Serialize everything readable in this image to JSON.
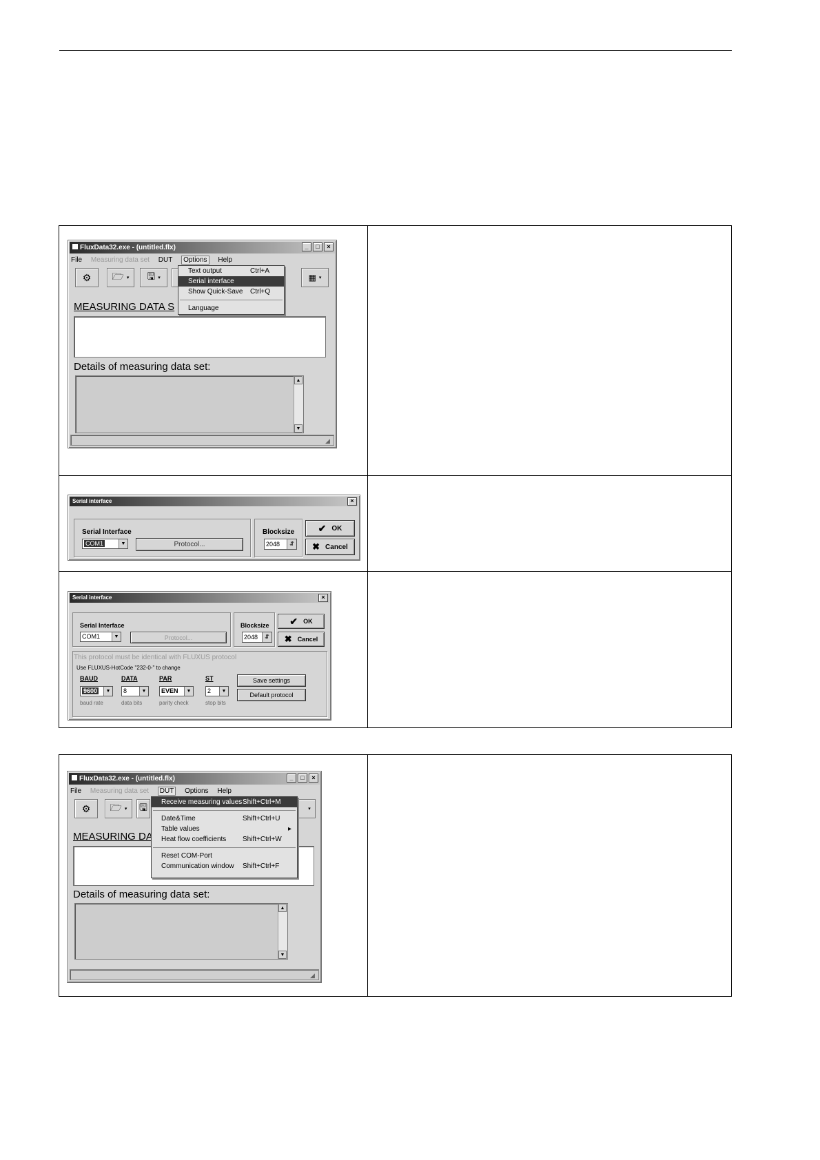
{
  "app": {
    "window_title": "FluxData32.exe - (untitled.flx)",
    "window_buttons": [
      "_",
      "□",
      "×"
    ],
    "menu": {
      "file": "File",
      "measuring_data_set": "Measuring data set",
      "dut": "DUT",
      "options": "Options",
      "help": "Help"
    },
    "measuring_data_label": "MEASURING DATA S",
    "measuring_data_label_short": "MEASURING DA",
    "details_label": "Details of measuring data set:"
  },
  "options_menu": {
    "items": [
      {
        "label": "Text output",
        "shortcut": "Ctrl+A"
      },
      {
        "label": "Serial interface",
        "shortcut": ""
      },
      {
        "label": "Show Quick-Save",
        "shortcut": "Ctrl+Q"
      },
      {
        "label": "Language",
        "shortcut": ""
      }
    ]
  },
  "dut_menu": {
    "items": [
      {
        "label": "Receive measuring values",
        "shortcut": "Shift+Ctrl+M"
      },
      {
        "label": "Date&Time",
        "shortcut": "Shift+Ctrl+U"
      },
      {
        "label": "Table values",
        "shortcut": "▸"
      },
      {
        "label": "Heat flow coefficients",
        "shortcut": "Shift+Ctrl+W"
      },
      {
        "label": "Reset COM-Port",
        "shortcut": ""
      },
      {
        "label": "Communication window",
        "shortcut": "Shift+Ctrl+F"
      }
    ]
  },
  "serial_dialog": {
    "title": "Serial interface",
    "close": "×",
    "group_label": "Serial Interface",
    "port_value": "COM1",
    "protocol_button": "Protocol...",
    "blocksize_label": "Blocksize",
    "blocksize_value": "2048",
    "ok_button": "OK",
    "cancel_button": "Cancel"
  },
  "serial_dialog_expanded": {
    "protocol_note": "This protocol must be identical with FLUXUS protocol",
    "hotcode_note": "Use FLUXUS-HotCode \"232-0-\" to change",
    "baud": {
      "label": "BAUD",
      "value": "9600",
      "caption": "baud rate"
    },
    "data": {
      "label": "DATA",
      "value": "8",
      "caption": "data bits"
    },
    "par": {
      "label": "PAR",
      "value": "EVEN",
      "caption": "parity check"
    },
    "st": {
      "label": "ST",
      "value": "2",
      "caption": "stop bits"
    },
    "save_button": "Save settings",
    "default_button": "Default protocol"
  }
}
